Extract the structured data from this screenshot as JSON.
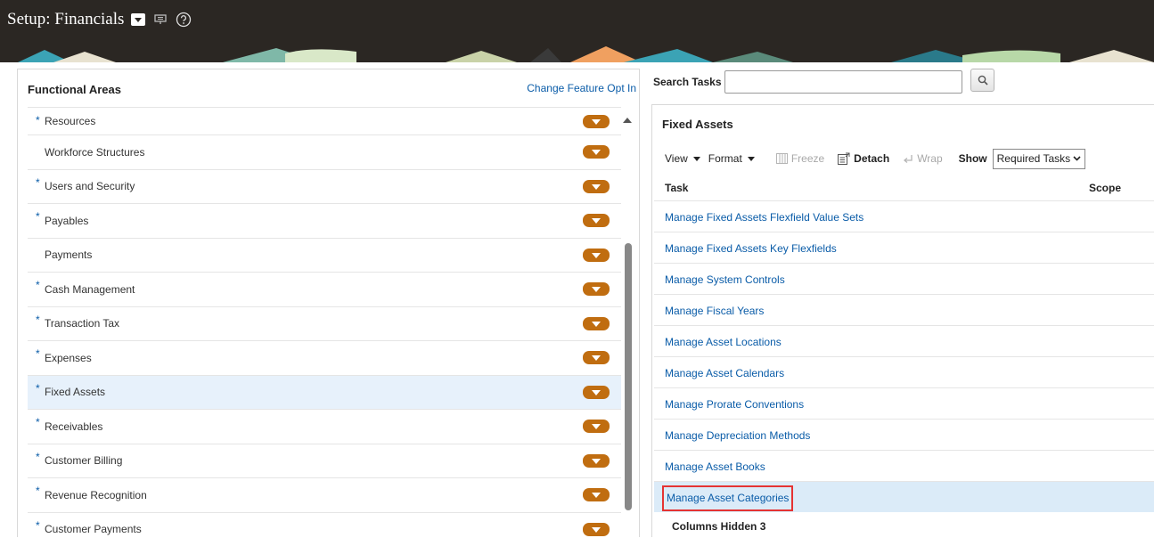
{
  "header": {
    "title": "Setup: Financials",
    "icons": [
      "dropdown-menu-icon",
      "monitor-icon",
      "help-icon"
    ]
  },
  "left_panel": {
    "title": "Functional Areas",
    "change_link": "Change Feature Opt In",
    "items": [
      {
        "label": "Resources",
        "required": "*"
      },
      {
        "label": "Workforce Structures",
        "required": ""
      },
      {
        "label": "Users and Security",
        "required": "*"
      },
      {
        "label": "Payables",
        "required": "*"
      },
      {
        "label": "Payments",
        "required": ""
      },
      {
        "label": "Cash Management",
        "required": "*"
      },
      {
        "label": "Transaction Tax",
        "required": "*"
      },
      {
        "label": "Expenses",
        "required": "*"
      },
      {
        "label": "Fixed Assets",
        "required": "*",
        "selected": true
      },
      {
        "label": "Receivables",
        "required": "*"
      },
      {
        "label": "Customer Billing",
        "required": "*"
      },
      {
        "label": "Revenue Recognition",
        "required": "*"
      },
      {
        "label": "Customer Payments",
        "required": "*"
      }
    ]
  },
  "search": {
    "label": "Search Tasks",
    "value": ""
  },
  "right_panel": {
    "title": "Fixed Assets",
    "toolbar": {
      "view": "View",
      "format": "Format",
      "freeze": "Freeze",
      "detach": "Detach",
      "wrap": "Wrap",
      "show_label": "Show",
      "show_value": "Required Tasks"
    },
    "columns": {
      "task": "Task",
      "scope": "Scope"
    },
    "tasks": [
      "Manage Fixed Assets Flexfield Value Sets",
      "Manage Fixed Assets Key Flexfields",
      "Manage System Controls",
      "Manage Fiscal Years",
      "Manage Asset Locations",
      "Manage Asset Calendars",
      "Manage Prorate Conventions",
      "Manage Depreciation Methods",
      "Manage Asset Books",
      "Manage Asset Categories"
    ],
    "columns_hidden_label": "Columns Hidden",
    "columns_hidden_count": "3"
  },
  "colors": {
    "header_bg": "#2b2723",
    "link": "#0a5ca8",
    "dropdown_button": "#c06d10",
    "selected_row": "#e7f1fb",
    "highlight_border": "#e53333"
  }
}
